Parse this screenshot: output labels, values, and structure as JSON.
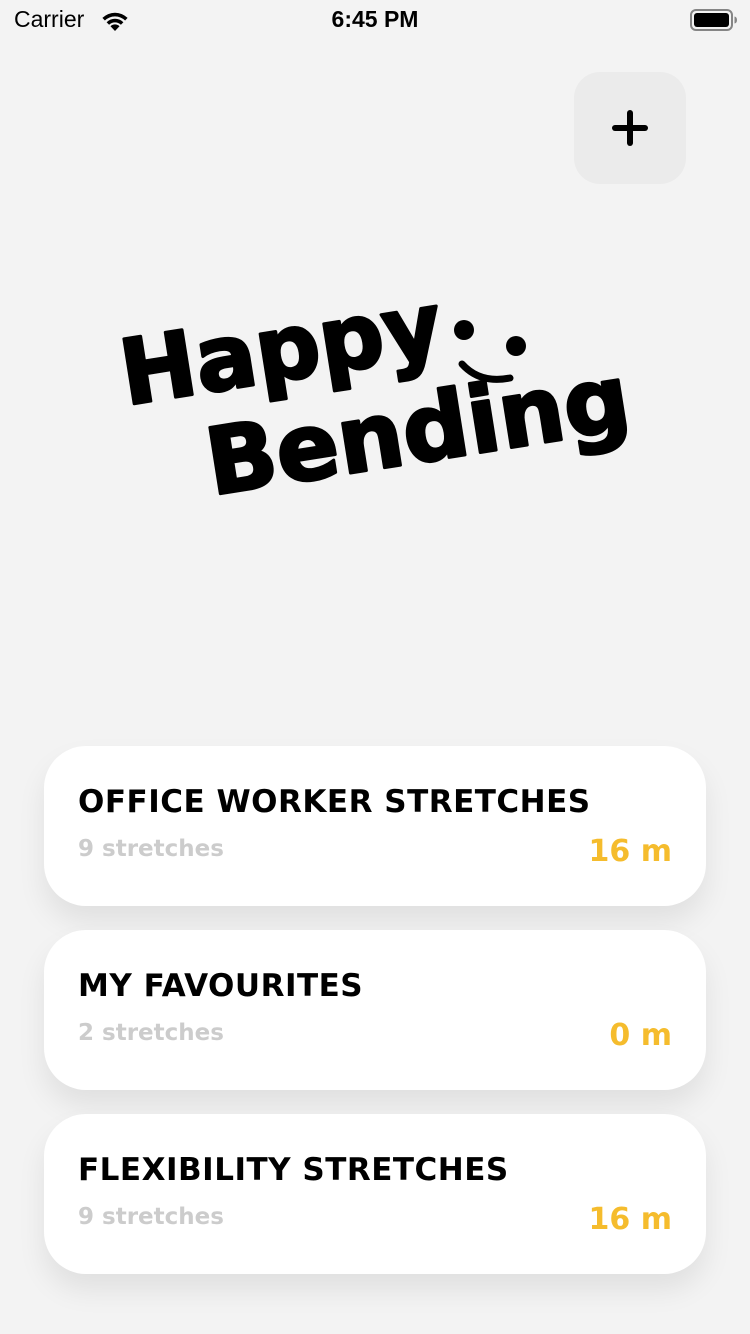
{
  "status_bar": {
    "carrier": "Carrier",
    "time": "6:45 PM",
    "wifi_icon": "wifi-icon",
    "battery_icon": "battery-full-icon"
  },
  "header": {
    "add_icon": "plus-icon"
  },
  "logo": {
    "line1": "Happy",
    "line2": "Bending",
    "emoticon": "smiley-face"
  },
  "colors": {
    "accent": "#f5bc2d",
    "background": "#f3f3f3",
    "card": "#ffffff",
    "muted_text": "#cccccc",
    "button_bg": "#ebebeb"
  },
  "routines": [
    {
      "title": "OFFICE WORKER STRETCHES",
      "count": "9 stretches",
      "duration": "16 m"
    },
    {
      "title": "MY FAVOURITES",
      "count": "2 stretches",
      "duration": "0 m"
    },
    {
      "title": "FLEXIBILITY STRETCHES",
      "count": "9 stretches",
      "duration": "16 m"
    }
  ]
}
